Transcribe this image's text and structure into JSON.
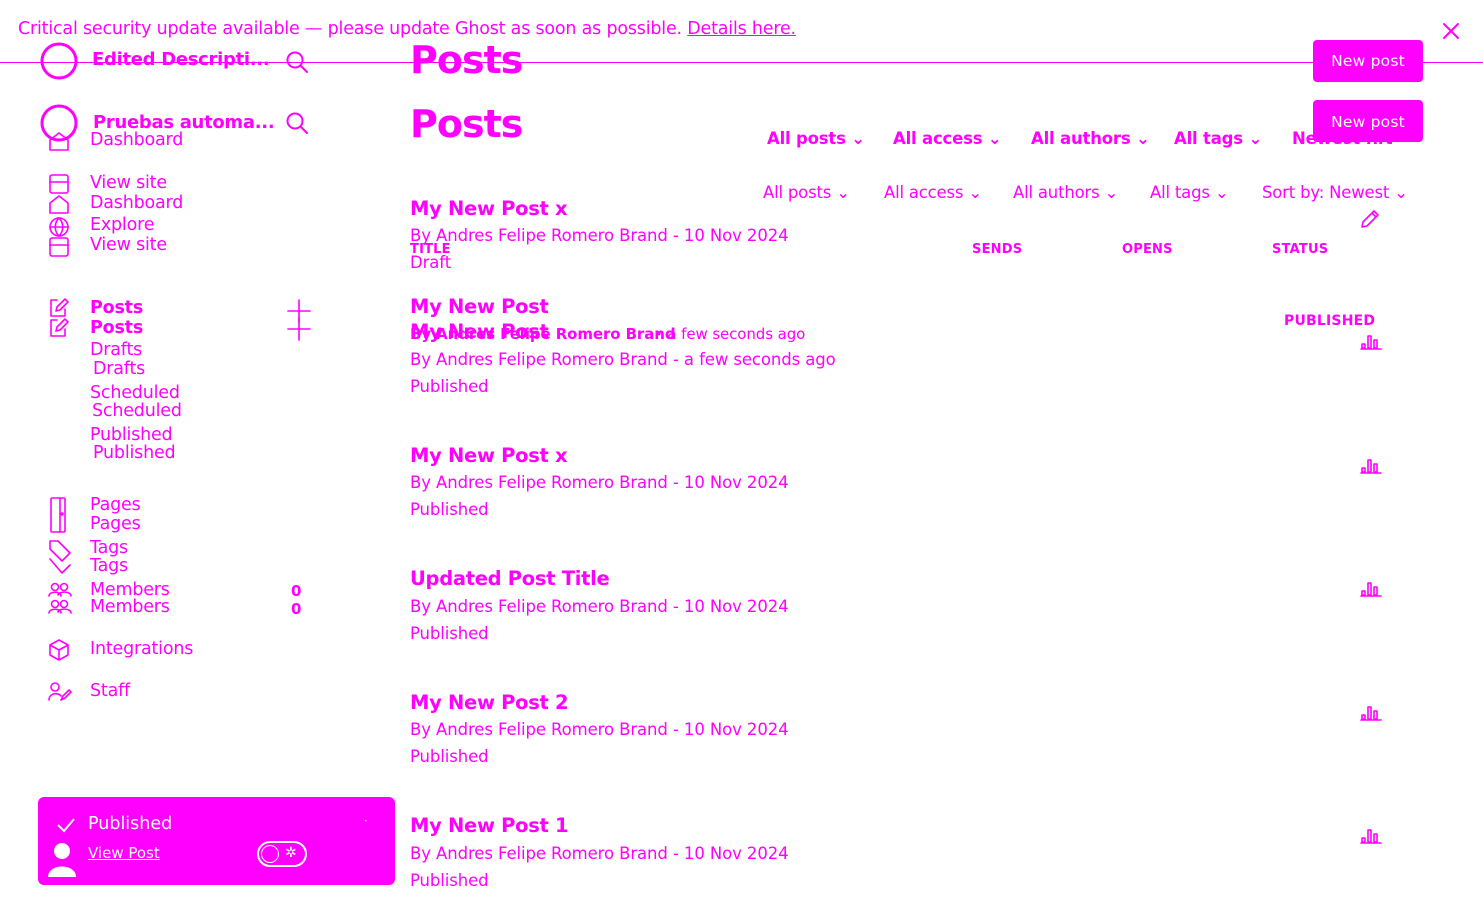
{
  "banner": {
    "message": "Critical security update available — please update Ghost as soon as possible.",
    "link": "Details here."
  },
  "sidebar": {
    "site_title_1": "Edited Descripti...",
    "site_title_2": "Pruebas automa...",
    "dashboard_ghost": "Dashboard",
    "view_site": "View site",
    "dashboard": "Dashboard",
    "explore": "Explore",
    "view_site_2": "View site",
    "posts": "Posts",
    "posts_2": "Posts",
    "drafts": "Drafts",
    "drafts_2": "Drafts",
    "scheduled": "Scheduled",
    "scheduled_2": "Scheduled",
    "published": "Published",
    "published_2": "Published",
    "pages": "Pages",
    "pages_2": "Pages",
    "tags": "Tags",
    "tags_2": "Tags",
    "members": "Members",
    "members_2": "Members",
    "members_count": "0",
    "members_count_2": "0",
    "integrations": "Integrations",
    "staff": "Staff"
  },
  "header": {
    "title": "Posts",
    "title_2": "Posts",
    "new_post": "New post",
    "new_post_2": "New post"
  },
  "filters": {
    "row1": {
      "all_posts": "All posts",
      "all_access": "All access",
      "all_authors": "All authors",
      "all_tags": "All tags",
      "sort": "Newest first"
    },
    "row2": {
      "all_posts": "All posts",
      "all_access": "All access",
      "all_authors": "All authors",
      "all_tags": "All tags",
      "sort": "Sort by: Newest"
    }
  },
  "columns": {
    "title": "TITLE",
    "sends": "SENDS",
    "opens": "OPENS",
    "status": "STATUS"
  },
  "posts": [
    {
      "title": "My New Post x",
      "meta": "By Andres Felipe Romero Brand - 10 Nov 2024",
      "status": "Draft"
    },
    {
      "title": "My New Post",
      "meta": "By Andres Felipe Romero Brand - a few seconds ago",
      "status": "Published"
    },
    {
      "title": "My New Post x",
      "meta": "By Andres Felipe Romero Brand - 10 Nov 2024",
      "status": "Published"
    },
    {
      "title": "Updated Post Title",
      "meta": "By Andres Felipe Romero Brand - 10 Nov 2024",
      "status": "Published"
    },
    {
      "title": "My New Post 2",
      "meta": "By Andres Felipe Romero Brand - 10 Nov 2024",
      "status": "Published"
    },
    {
      "title": "My New Post 1",
      "meta": "By Andres Felipe Romero Brand - 10 Nov 2024",
      "status": "Published"
    }
  ],
  "ghost_row": {
    "title": "My New Post",
    "author": "By Andres Felipe Romero Brand",
    "time": "• a few seconds ago",
    "status": "PUBLISHED"
  },
  "toast": {
    "message": "Published",
    "link": "View Post"
  },
  "colors": {
    "accent": "#ff00ff",
    "background": "#ffffff"
  }
}
